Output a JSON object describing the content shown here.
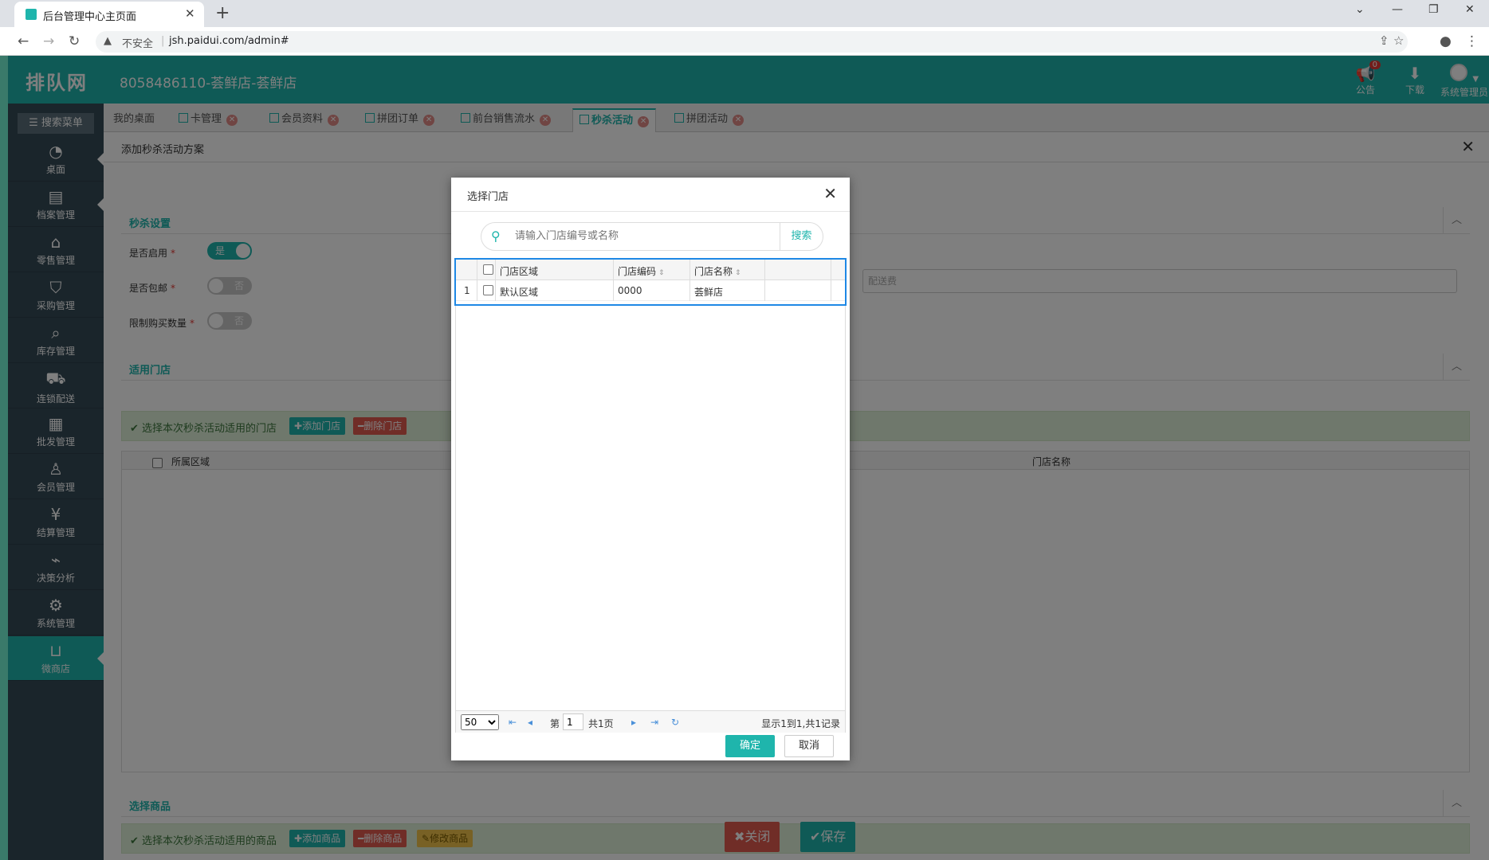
{
  "browser": {
    "tab_title": "后台管理中心主页面",
    "omnibox_insecure": "不安全",
    "omnibox_url": "jsh.paidui.com/admin#"
  },
  "header": {
    "logo": "排队网",
    "shop": "8058486110-荟鲜店-荟鲜店",
    "notice_label": "公告",
    "notice_badge": "0",
    "download_label": "下载",
    "user_label": "系统管理员"
  },
  "sidebar": {
    "search_label": "搜索菜单",
    "items": [
      {
        "label": "桌面",
        "icon": "dashboard-icon"
      },
      {
        "label": "档案管理",
        "icon": "archive-icon"
      },
      {
        "label": "零售管理",
        "icon": "store-icon"
      },
      {
        "label": "采购管理",
        "icon": "purchase-icon"
      },
      {
        "label": "库存管理",
        "icon": "inventory-icon"
      },
      {
        "label": "连锁配送",
        "icon": "delivery-icon"
      },
      {
        "label": "批发管理",
        "icon": "wholesale-icon"
      },
      {
        "label": "会员管理",
        "icon": "member-icon"
      },
      {
        "label": "结算管理",
        "icon": "settlement-icon"
      },
      {
        "label": "决策分析",
        "icon": "analysis-icon"
      },
      {
        "label": "系统管理",
        "icon": "settings-icon"
      },
      {
        "label": "微商店",
        "icon": "shop-bag-icon"
      }
    ]
  },
  "tabs": [
    "我的桌面",
    "卡管理",
    "会员资料",
    "拼团订单",
    "前台销售流水",
    "秒杀活动",
    "拼团活动"
  ],
  "panel": {
    "title": "添加秒杀活动方案"
  },
  "form": {
    "section_title": "秒杀设置",
    "enable_label": "是否启用",
    "enable_value": "是",
    "free_ship_label": "是否包邮",
    "free_ship_value": "否",
    "limit_label": "限制购买数量",
    "limit_value": "否",
    "ship_fee_placeholder": "配送费"
  },
  "stores_section": {
    "title": "适用门店",
    "tip": "选择本次秒杀活动适用的门店",
    "add_btn": "添加门店",
    "del_btn": "删除门店",
    "col_region": "所属区域",
    "col_name": "门店名称"
  },
  "goods_section": {
    "title": "选择商品",
    "tip": "选择本次秒杀活动适用的商品",
    "add_btn": "添加商品",
    "del_btn": "删除商品",
    "edit_btn": "修改商品"
  },
  "footer": {
    "close": "关闭",
    "save": "保存"
  },
  "modal": {
    "title": "选择门店",
    "search_placeholder": "请输入门店编号或名称",
    "search_btn": "搜索",
    "columns": [
      "门店区域",
      "门店编码",
      "门店名称"
    ],
    "rows": [
      {
        "no": "1",
        "region": "默认区域",
        "code": "0000",
        "name": "荟鲜店"
      }
    ],
    "page_size": "50",
    "page_prefix": "第",
    "page_num": "1",
    "page_total": "共1页",
    "summary": "显示1到1,共1记录",
    "ok": "确定",
    "cancel": "取消"
  }
}
